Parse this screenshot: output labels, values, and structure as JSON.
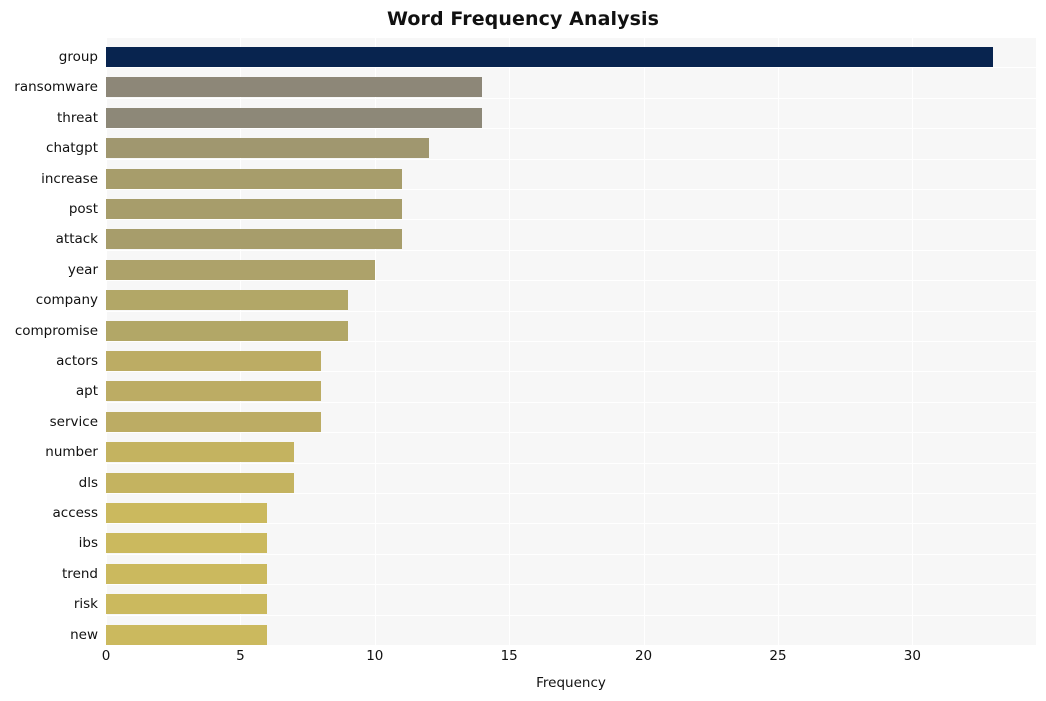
{
  "chart_data": {
    "type": "bar",
    "orientation": "horizontal",
    "title": "Word Frequency Analysis",
    "xlabel": "Frequency",
    "ylabel": "",
    "categories": [
      "group",
      "ransomware",
      "threat",
      "chatgpt",
      "increase",
      "post",
      "attack",
      "year",
      "company",
      "compromise",
      "actors",
      "apt",
      "service",
      "number",
      "dls",
      "access",
      "ibs",
      "trend",
      "risk",
      "new"
    ],
    "values": [
      33,
      14,
      14,
      12,
      11,
      11,
      11,
      10,
      9,
      9,
      8,
      8,
      8,
      7,
      7,
      6,
      6,
      6,
      6,
      6
    ],
    "bar_colors": [
      "#08244f",
      "#8d8778",
      "#8d8878",
      "#a0976f",
      "#a79d6b",
      "#a79d6b",
      "#a79d6b",
      "#ada26a",
      "#b2a767",
      "#b2a767",
      "#bcac64",
      "#bcac64",
      "#bcac64",
      "#c4b360",
      "#c4b360",
      "#cbb95e",
      "#cbb95e",
      "#cbb95e",
      "#cbb95e",
      "#cbb95e"
    ],
    "xticks": [
      0,
      5,
      10,
      15,
      20,
      25,
      30
    ],
    "xtick_labels": [
      "0",
      "5",
      "10",
      "15",
      "20",
      "25",
      "30"
    ],
    "xlim": [
      0,
      34.6
    ],
    "grid": true,
    "grid_color": "#ffffff",
    "plot_background": "#f7f7f7",
    "figure_background": "#ffffff",
    "legend": null
  }
}
